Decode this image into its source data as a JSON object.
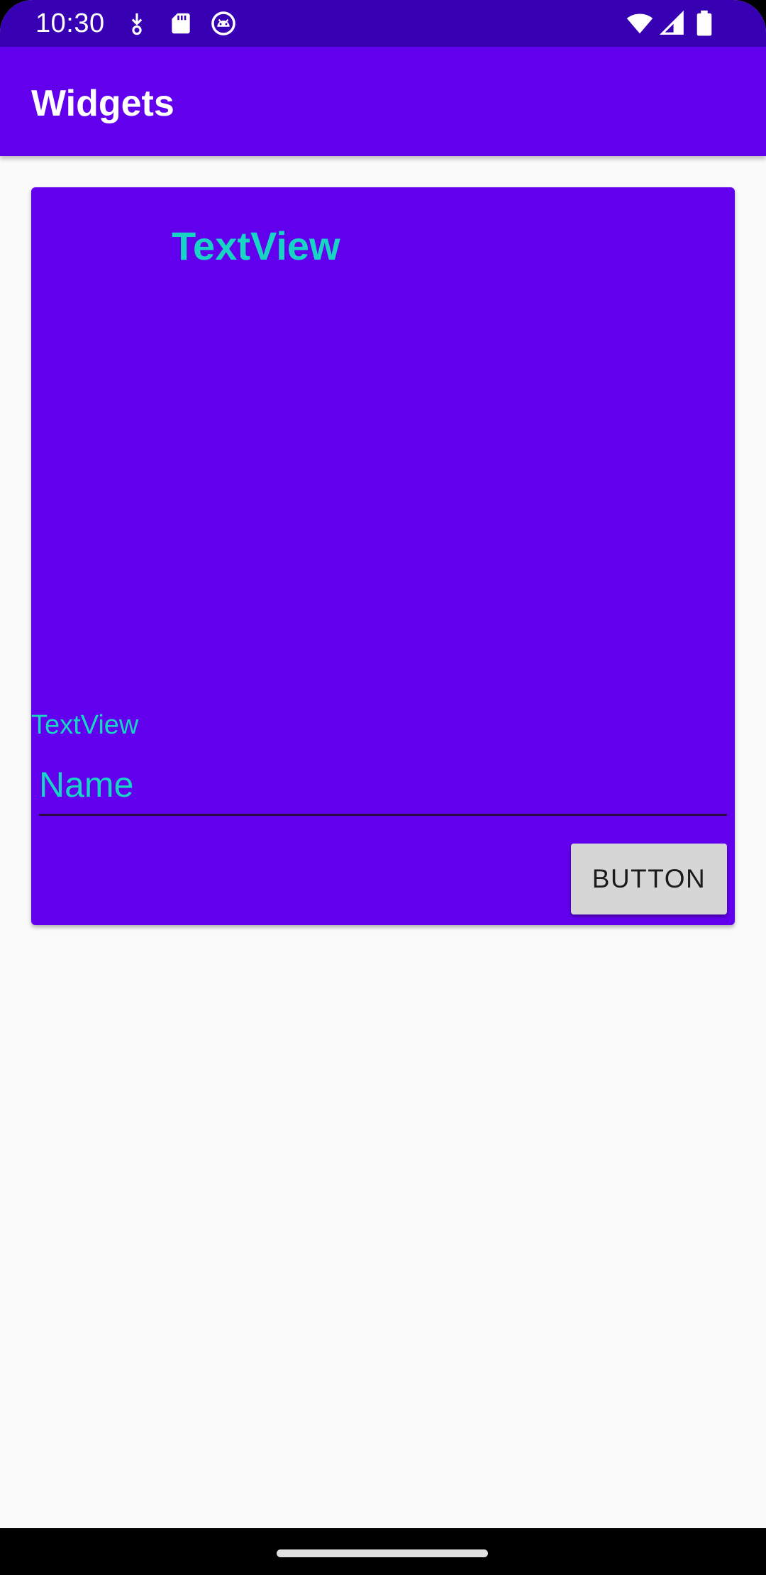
{
  "status_bar": {
    "time": "10:30",
    "left_icons": [
      "download-notification-icon",
      "sd-card-icon",
      "android-debug-icon"
    ],
    "right_icons": [
      "wifi-icon",
      "cell-signal-icon",
      "battery-icon"
    ],
    "background": "#3700b3"
  },
  "app_bar": {
    "title": "Widgets",
    "background": "#6200ee"
  },
  "card": {
    "background": "#6200ee",
    "title": "TextView",
    "label": "TextView",
    "name_field": {
      "placeholder": "Name",
      "value": ""
    },
    "button_label": "BUTTON",
    "text_color": "#18d4c4"
  },
  "nav_bar": {
    "handle": "home-gesture-handle"
  }
}
